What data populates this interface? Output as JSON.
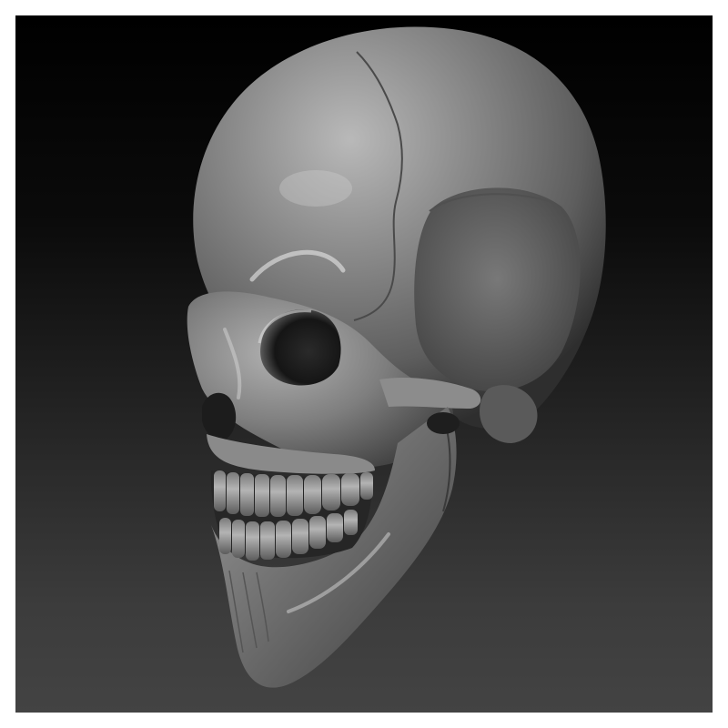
{
  "scene": {
    "subject": "skull-sculpt",
    "colors": {
      "frame": "#ffffff",
      "background_top": "#000000",
      "background_bottom": "#434343",
      "material_base": "#8a8a8a",
      "material_highlight": "#e6e6e6",
      "material_shadow": "#1e1e1e"
    }
  }
}
